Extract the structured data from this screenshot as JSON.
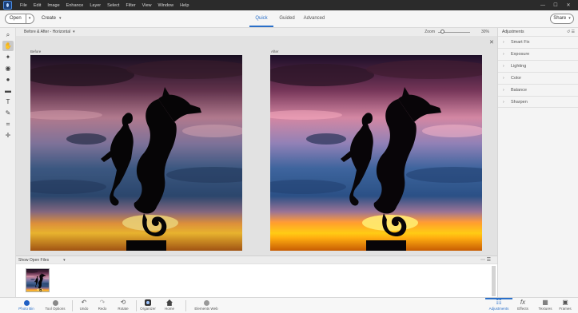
{
  "menu": [
    "File",
    "Edit",
    "Image",
    "Enhance",
    "Layer",
    "Select",
    "Filter",
    "View",
    "Window",
    "Help"
  ],
  "window_controls": {
    "minimize": "—",
    "maximize": "☐",
    "close": "✕"
  },
  "toolbar": {
    "open_label": "Open",
    "create_label": "Create",
    "modes": [
      "Quick",
      "Guided",
      "Advanced"
    ],
    "active_mode": "Quick",
    "share_label": "Share"
  },
  "options": {
    "view": "Before & After - Horizontal",
    "zoom_label": "Zoom",
    "zoom_value": "30%",
    "zoom_fraction": 0.15
  },
  "canvas": {
    "before_label": "Before",
    "after_label": "After"
  },
  "adjustments": {
    "title": "Adjustments",
    "items": [
      "Smart Fix",
      "Exposure",
      "Lighting",
      "Color",
      "Balance",
      "Sharpen"
    ]
  },
  "bin": {
    "select_label": "Show Open Files"
  },
  "taskbar": [
    {
      "label": "Photo Bin",
      "icon": "photo-bin-icon",
      "active": true
    },
    {
      "label": "Tool Options",
      "icon": "tool-options-icon"
    },
    {
      "label": "Undo",
      "icon": "undo-icon"
    },
    {
      "label": "Redo",
      "icon": "redo-icon"
    },
    {
      "label": "Rotate",
      "icon": "rotate-icon"
    },
    {
      "label": "Organizer",
      "icon": "organizer-icon"
    },
    {
      "label": "Home",
      "icon": "home-icon"
    },
    {
      "label": "Elements Web",
      "icon": "elements-web-icon"
    },
    {
      "label": "Adjustments",
      "icon": "adjustments-icon",
      "active": true
    },
    {
      "label": "Effects",
      "icon": "effects-icon"
    },
    {
      "label": "Textures",
      "icon": "textures-icon"
    },
    {
      "label": "Frames",
      "icon": "frames-icon"
    }
  ],
  "colors": {
    "accent": "#2a6fc9",
    "menubar": "#2b2b2b"
  }
}
